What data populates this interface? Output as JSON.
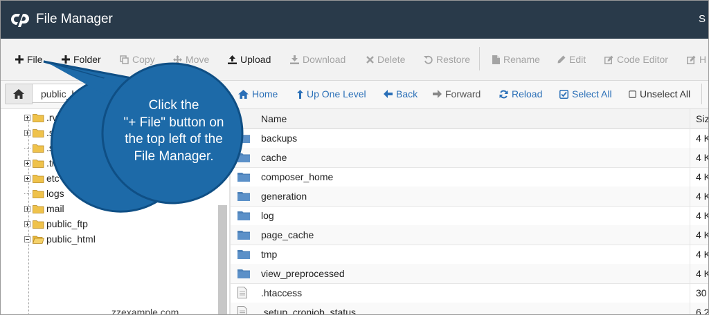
{
  "header": {
    "title": "File Manager",
    "user_initial": "S",
    "bg_color": "#293a4a"
  },
  "toolbar": {
    "file": "File",
    "folder": "Folder",
    "copy": "Copy",
    "move": "Move",
    "upload": "Upload",
    "download": "Download",
    "delete": "Delete",
    "restore": "Restore",
    "rename": "Rename",
    "edit": "Edit",
    "code_editor": "Code Editor",
    "html_editor": "H"
  },
  "pathbar": {
    "path_value": "public_html",
    "home": "Home",
    "up_one_level": "Up One Level",
    "back": "Back",
    "forward": "Forward",
    "reload": "Reload",
    "select_all": "Select All",
    "unselect_all": "Unselect All"
  },
  "tree": {
    "items": [
      {
        "label": ".rvsitebuilde",
        "expandable": true
      },
      {
        "label": ".softaculous",
        "expandable": true
      },
      {
        "label": ".ssh",
        "expandable": false
      },
      {
        "label": ".trash",
        "expandable": true
      },
      {
        "label": "etc",
        "expandable": true
      },
      {
        "label": "logs",
        "expandable": false
      },
      {
        "label": "mail",
        "expandable": true
      },
      {
        "label": "public_ftp",
        "expandable": true
      },
      {
        "label": "public_html",
        "expandable": true
      }
    ],
    "domain": "zzexample.com"
  },
  "file_list": {
    "columns": {
      "name": "Name",
      "size": "Siz"
    },
    "rows": [
      {
        "name": "backups",
        "size": "4 K",
        "type": "folder"
      },
      {
        "name": "cache",
        "size": "4 K",
        "type": "folder"
      },
      {
        "name": "composer_home",
        "size": "4 K",
        "type": "folder"
      },
      {
        "name": "generation",
        "size": "4 K",
        "type": "folder"
      },
      {
        "name": "log",
        "size": "4 K",
        "type": "folder"
      },
      {
        "name": "page_cache",
        "size": "4 K",
        "type": "folder"
      },
      {
        "name": "tmp",
        "size": "4 K",
        "type": "folder"
      },
      {
        "name": "view_preprocessed",
        "size": "4 K",
        "type": "folder"
      },
      {
        "name": ".htaccess",
        "size": "30",
        "type": "file"
      },
      {
        "name": ".setup_cronjob_status",
        "size": "6.2",
        "type": "file"
      }
    ]
  },
  "callout": {
    "line1": "Click the",
    "line2": "\"+ File\" button on",
    "line3": "the top left of the",
    "line4": "File Manager.",
    "color": "#1d6aa8"
  },
  "colors": {
    "link_blue": "#2a6fb7",
    "folder_yellow": "#e8b93c",
    "folder_blue": "#4b80b8"
  }
}
